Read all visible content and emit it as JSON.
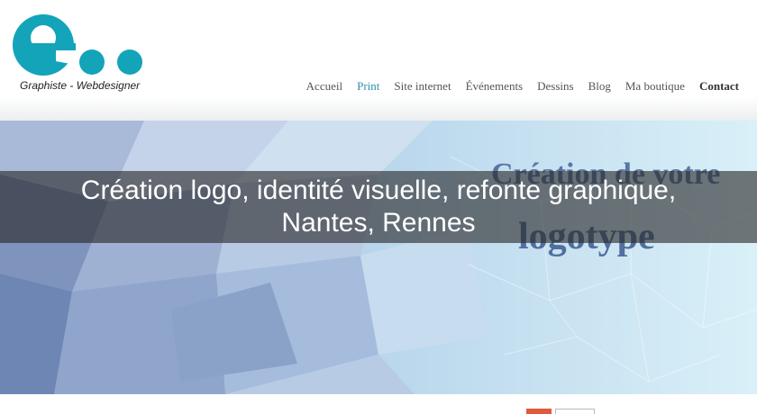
{
  "logo": {
    "letter": "e",
    "tagline": "Graphiste - Webdesigner",
    "color": "#13a4b9"
  },
  "nav": {
    "items": [
      {
        "label": "Accueil"
      },
      {
        "label": "Print",
        "active": true
      },
      {
        "label": "Site internet"
      },
      {
        "label": "Événements"
      },
      {
        "label": "Dessins"
      },
      {
        "label": "Blog"
      },
      {
        "label": "Ma boutique"
      },
      {
        "label": "Contact",
        "bold": true
      }
    ],
    "active_color": "#2b8fae"
  },
  "hero": {
    "title_line1": "Création logo, identité visuelle, refonte graphique,",
    "title_line2": "Nantes, Rennes",
    "bg_text_line1": "Création de votre",
    "bg_text_line2": "logotype"
  },
  "colors": {
    "share_red": "#e05a3c"
  }
}
